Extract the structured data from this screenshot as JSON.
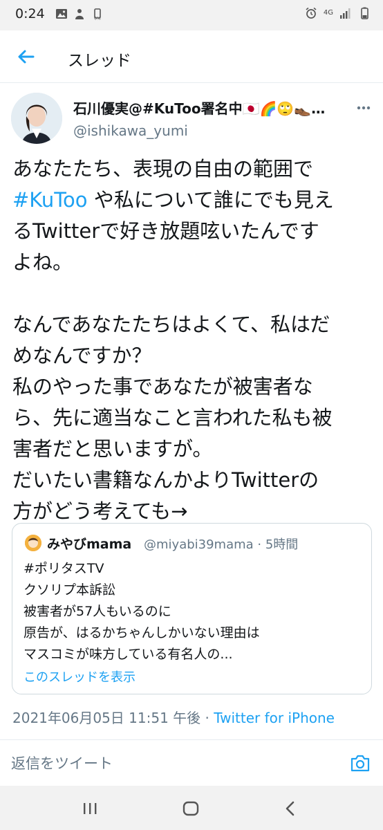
{
  "status_bar": {
    "time": "0:24",
    "network": "4G",
    "icons_left": [
      "image-icon",
      "notification-icon",
      "battery-saver-icon"
    ],
    "icons_right": [
      "alarm-icon",
      "network-4g-icon",
      "signal-icon",
      "battery-icon"
    ]
  },
  "header": {
    "title": "スレッド"
  },
  "tweet": {
    "display_name": "石川優実@#KuToo署名中🇯🇵🌈🙄👞…",
    "handle": "@ishikawa_yumi",
    "text": {
      "l1": "あなたたち、表現の自由の範囲で",
      "hashtag": "#KuToo",
      "l2_rest": " や私について誰にでも見え",
      "l3": "るTwitterで好き放題呟いたんです",
      "l4": "よね。",
      "l5": "なんであなたたちはよくて、私はだ",
      "l6": "めなんですか？",
      "l7": "私のやった事であなたが被害者な",
      "l8": "ら、先に適当なこと言われた私も被",
      "l9": "害者だと思いますが。",
      "l10": "だいたい書籍なんかよりTwitterの",
      "l11": "方がどう考えても→"
    },
    "timestamp": "2021年06月05日 11:51 午後 · ",
    "source": "Twitter for iPhone"
  },
  "quote": {
    "name": "みやびmama",
    "meta": "@miyabi39mama · 5時間",
    "lines": [
      "#ポリタスTV",
      "クソリプ本訴訟",
      "被害者が57人もいるのに",
      "原告が、はるかちゃんしかいない理由は",
      "マスコミが味方している有名人の..."
    ],
    "show_thread": "このスレッドを表示"
  },
  "reply": {
    "placeholder": "返信をツイート"
  },
  "colors": {
    "accent": "#1da1f2",
    "text": "#14171a",
    "secondary": "#657786",
    "border": "#cfd9de",
    "system_bar": "#f2f2f2"
  }
}
